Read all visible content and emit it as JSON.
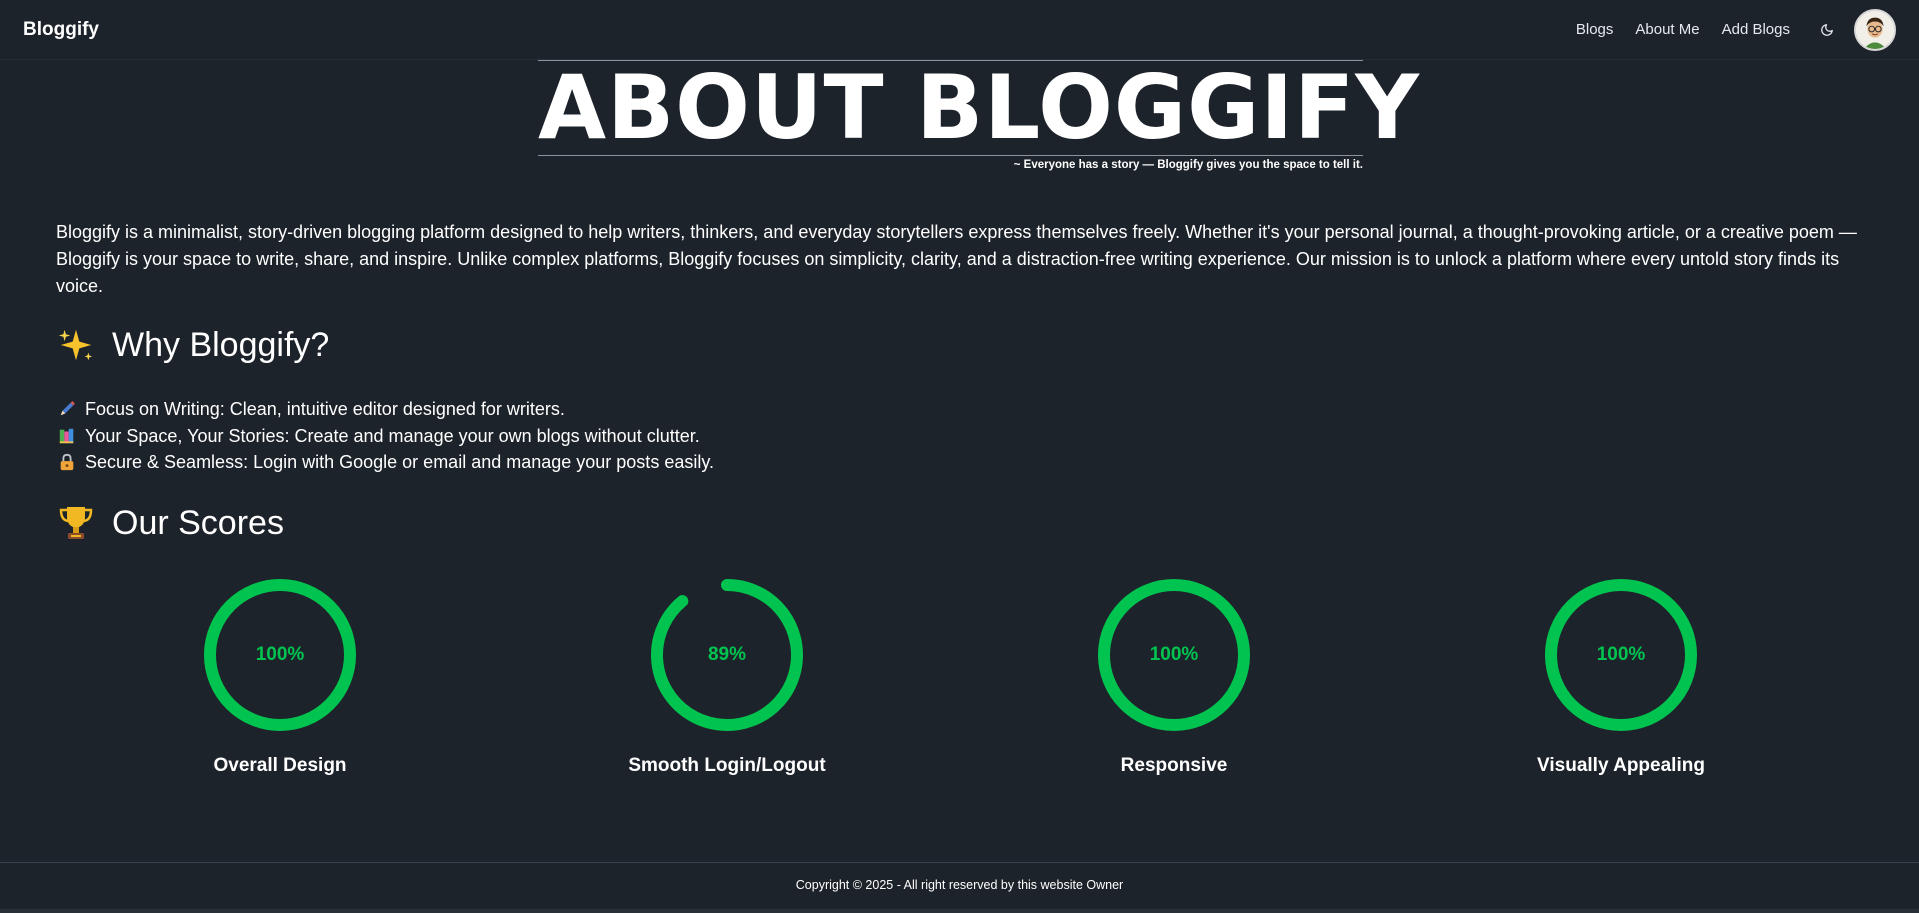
{
  "navbar": {
    "brand": "Bloggify",
    "links": [
      "Blogs",
      "About Me",
      "Add Blogs"
    ],
    "theme_icon": "moon-icon",
    "avatar_icon": "user-avatar"
  },
  "hero": {
    "title": "ABOUT BLOGGIFY",
    "tagline": "~ Everyone has a story — Bloggify gives you the space to tell it."
  },
  "intro": "Bloggify is a minimalist, story-driven blogging platform designed to help writers, thinkers, and everyday storytellers express themselves freely. Whether it's your personal journal, a thought-provoking article, or a creative poem — Bloggify is your space to write, share, and inspire. Unlike complex platforms, Bloggify focuses on simplicity, clarity, and a distraction-free writing experience. Our mission is to unlock a platform where every untold story finds its voice.",
  "why": {
    "heading": "Why Bloggify?",
    "icon": "sparkles-icon",
    "features": [
      {
        "icon": "pen-icon",
        "text": "Focus on Writing: Clean, intuitive editor designed for writers."
      },
      {
        "icon": "books-icon",
        "text": "Your Space, Your Stories: Create and manage your own blogs without clutter."
      },
      {
        "icon": "lock-icon",
        "text": "Secure & Seamless: Login with Google or email and manage your posts easily."
      }
    ]
  },
  "scores": {
    "heading": "Our Scores",
    "icon": "trophy-icon",
    "accent": "#00c44f",
    "items": [
      {
        "label": "Overall Design",
        "value": 100,
        "text": "100%"
      },
      {
        "label": "Smooth Login/Logout",
        "value": 89,
        "text": "89%"
      },
      {
        "label": "Responsive",
        "value": 100,
        "text": "100%"
      },
      {
        "label": "Visually Appealing",
        "value": 100,
        "text": "100%"
      }
    ]
  },
  "footer": {
    "text": "Copyright © 2025 - All right reserved by this website Owner"
  }
}
